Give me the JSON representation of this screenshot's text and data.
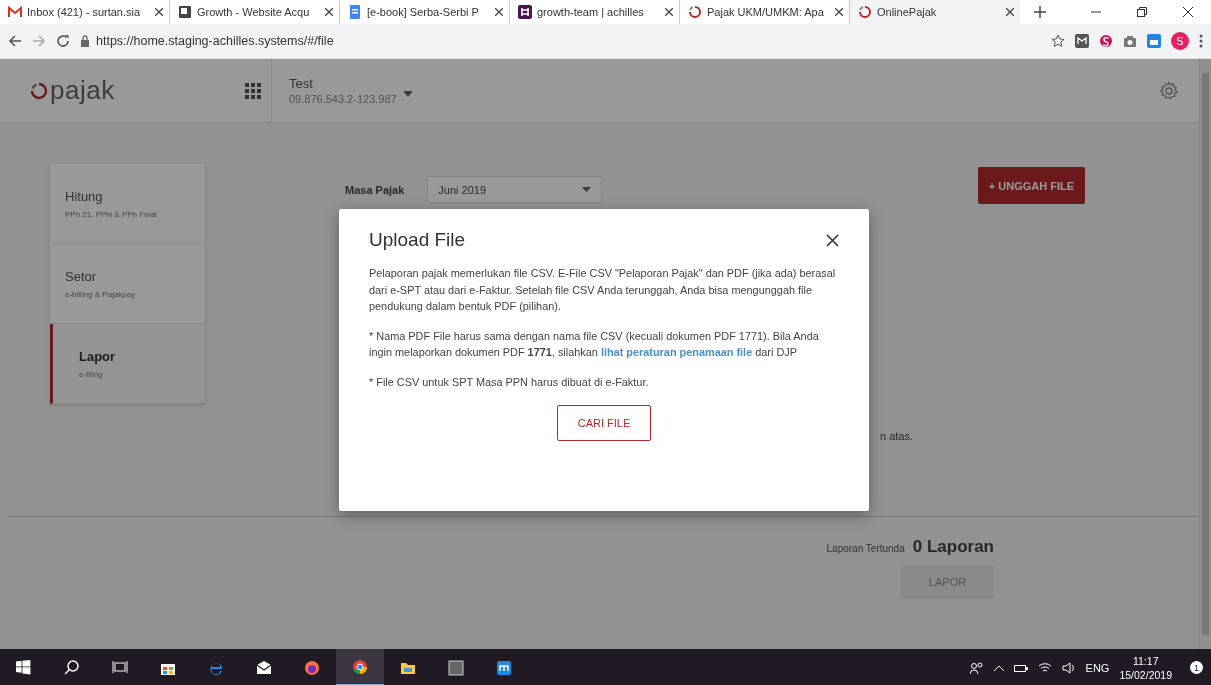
{
  "browser": {
    "tabs": [
      {
        "title": "Inbox (421) - surtan.sia",
        "kind": "mail",
        "selected": false
      },
      {
        "title": "Growth - Website Acqu",
        "kind": "slides",
        "selected": false
      },
      {
        "title": "[e-book] Serba-Serbi P",
        "kind": "docs",
        "selected": false
      },
      {
        "title": "growth-team | achilles",
        "kind": "chat",
        "selected": false
      },
      {
        "title": "Pajak UKM/UMKM: Apa",
        "kind": "ring",
        "selected": false
      },
      {
        "title": "OnlinePajak",
        "kind": "ring",
        "selected": true
      }
    ],
    "url": "https://home.staging-achilles.systems/#/file",
    "avatar": "S"
  },
  "app": {
    "logo": "pajak",
    "company": {
      "name": "Test",
      "npwp": "09.876.543.2-123.987"
    }
  },
  "sidebar": [
    {
      "label": "Hitung",
      "sub": "PPh 21, PPN & PPh Final",
      "selected": false
    },
    {
      "label": "Setor",
      "sub": "e-billing & Pajakpay",
      "selected": false
    },
    {
      "label": "Lapor",
      "sub": "e-filing",
      "selected": true
    }
  ],
  "filter": {
    "label": "Masa Pajak",
    "value": "Juni 2019"
  },
  "upload_button": "+ UNGGAH FILE",
  "partial_text": "n atas.",
  "pending": {
    "label": "Laporan Tertunda",
    "count": "0 Laporan"
  },
  "report_button": {
    "label": "LAPOR",
    "disabled": true
  },
  "modal": {
    "title": "Upload File",
    "paragraphs": [
      {
        "text": "Pelaporan pajak memerlukan file CSV. E-File CSV \"Pelaporan Pajak\" dan PDF (jika ada) berasal dari e-SPT atau dari e-Faktur. Setelah file CSV Anda terunggah, Anda bisa mengunggah file pendukung dalam bentuk PDF (pilihan)."
      },
      {
        "text": "* Nama PDF File harus sama dengan nama file CSV (kecuali dokumen PDF 1771). Bila Anda ingin melaporkan dokumen PDF **1771**, silahkan ",
        "link": "lihat peraturan penamaan file",
        "after": " dari DJP"
      },
      {
        "text": "* File CSV untuk SPT Masa PPN harus dibuat di e-Faktur."
      }
    ],
    "button": "CARI FILE"
  },
  "taskbar": {
    "language": "ENG",
    "time": "11:17",
    "date": "15/02/2019",
    "notifications": "1"
  }
}
